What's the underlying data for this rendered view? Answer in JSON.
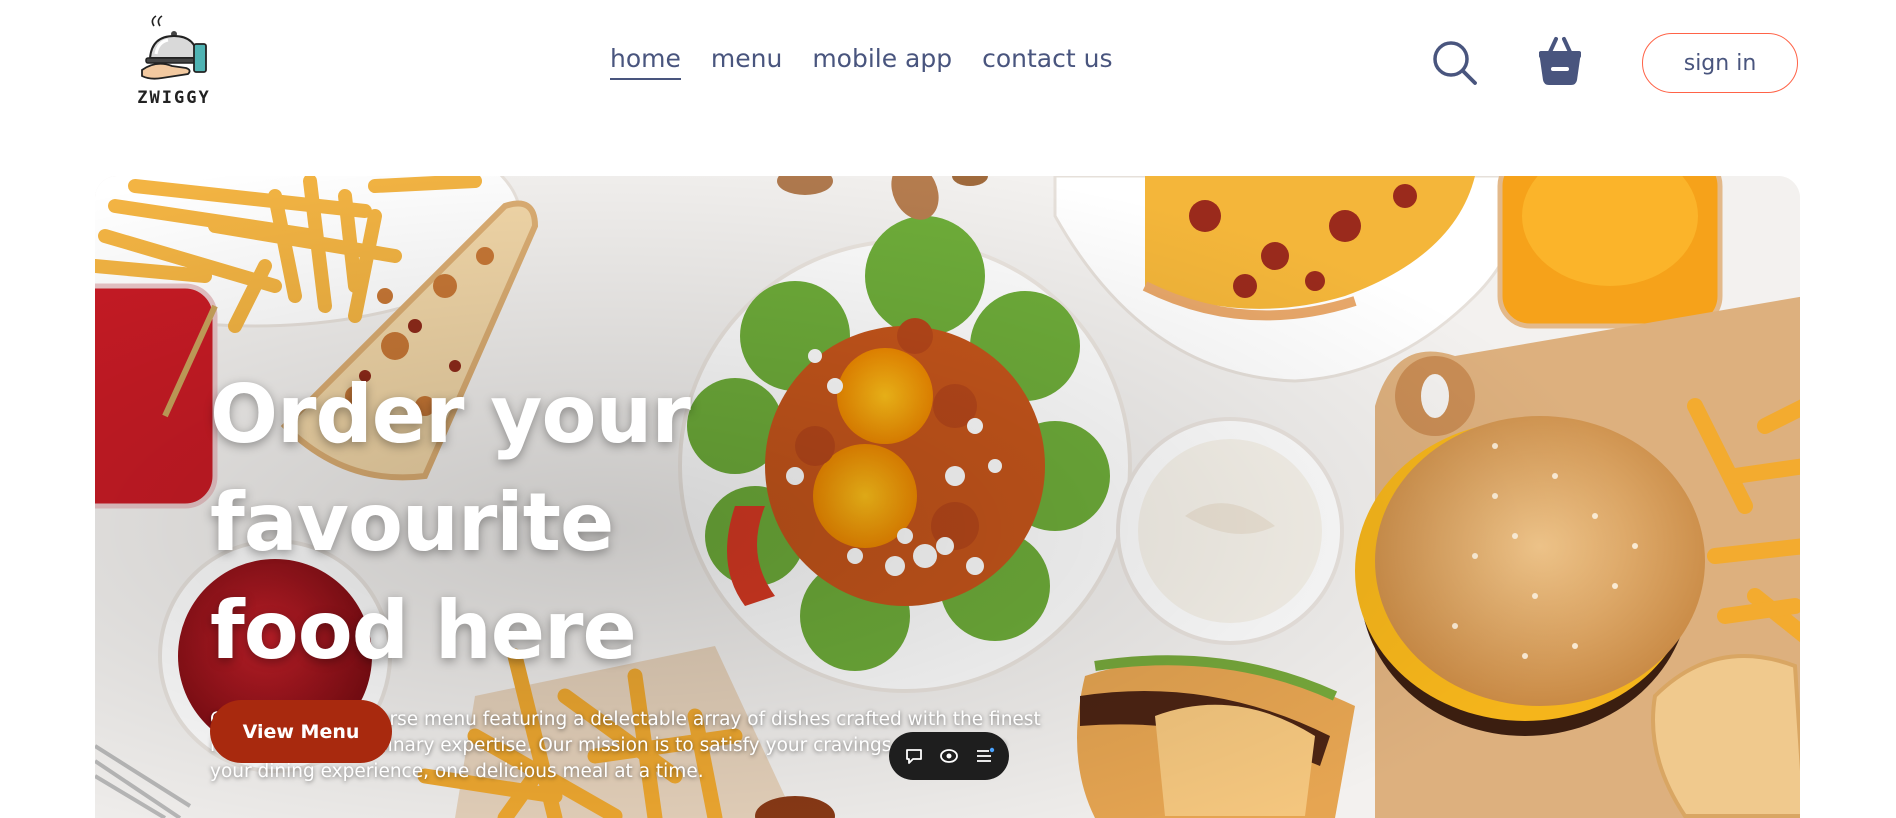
{
  "brand": {
    "logo_text": "ZWIGGY"
  },
  "nav": {
    "links": [
      {
        "label": "home",
        "active": true
      },
      {
        "label": "menu",
        "active": false
      },
      {
        "label": "mobile app",
        "active": false
      },
      {
        "label": "contact us",
        "active": false
      }
    ],
    "signin_label": "sign in",
    "icons": [
      "search-icon",
      "basket-icon"
    ]
  },
  "hero": {
    "title_line1": "Order your favourite",
    "title_line2": "food here",
    "description": "Choose from a diverse menu featuring a delectable array of dishes crafted with the finest ingredients and culinary expertise. Our mission is to satisfy your cravings and elevate your dining experience, one delicious meal at a time.",
    "button_label": "View Menu"
  },
  "toolbar": {
    "icons": [
      "comment-icon",
      "eye-icon",
      "list-icon"
    ]
  },
  "colors": {
    "accent": "#ff6347",
    "nav_text": "#49557e",
    "button": "#a8290e"
  }
}
